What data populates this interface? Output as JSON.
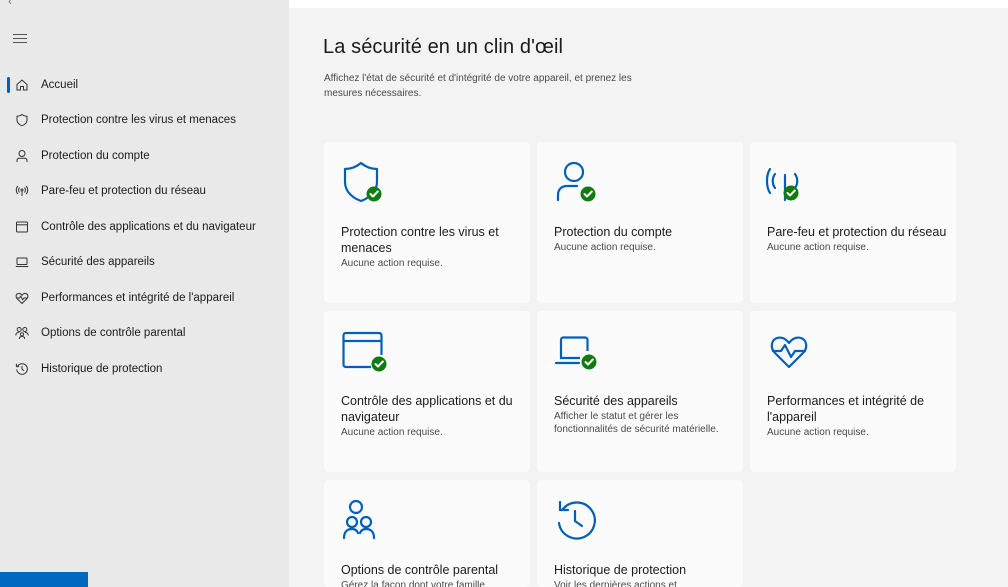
{
  "sidebar": {
    "back_glyph": "‹",
    "items": [
      {
        "label": "Accueil",
        "icon": "home-icon",
        "active": true
      },
      {
        "label": "Protection contre les virus et menaces",
        "icon": "shield-icon"
      },
      {
        "label": "Protection du compte",
        "icon": "person-icon"
      },
      {
        "label": "Pare-feu et protection du réseau",
        "icon": "wifi-signal-icon"
      },
      {
        "label": "Contrôle des applications et du navigateur",
        "icon": "app-window-icon"
      },
      {
        "label": "Sécurité des appareils",
        "icon": "laptop-icon"
      },
      {
        "label": "Performances et intégrité de l'appareil",
        "icon": "heart-pulse-icon"
      },
      {
        "label": "Options de contrôle parental",
        "icon": "family-icon"
      },
      {
        "label": "Historique de protection",
        "icon": "history-icon"
      }
    ]
  },
  "main": {
    "title": "La sécurité en un clin d'œil",
    "subtitle": "Affichez l'état de sécurité et d'intégrité de votre appareil, et prenez les mesures nécessaires.",
    "cards": [
      {
        "title": "Protection contre les virus et menaces",
        "status": "Aucune action requise.",
        "icon": "shield-check-icon"
      },
      {
        "title": "Protection du compte",
        "status": "Aucune action requise.",
        "icon": "person-check-icon"
      },
      {
        "title": "Pare-feu et protection du réseau",
        "status": "Aucune action requise.",
        "icon": "wifi-check-icon"
      },
      {
        "title": "Contrôle des applications et du navigateur",
        "status": "Aucune action requise.",
        "icon": "app-window-check-icon"
      },
      {
        "title": "Sécurité des appareils",
        "status": "Afficher le statut et gérer les fonctionnalités de sécurité matérielle.",
        "icon": "laptop-check-icon"
      },
      {
        "title": "Performances et intégrité de l'appareil",
        "status": "Aucune action requise.",
        "icon": "heart-pulse-icon"
      },
      {
        "title": "Options de contrôle parental",
        "status": "Gérez la façon dont votre famille",
        "icon": "family-icon"
      },
      {
        "title": "Historique de protection",
        "status": "Voir les dernières actions et",
        "icon": "history-icon"
      }
    ]
  },
  "colors": {
    "accent": "#005fb8",
    "check": "#107c10",
    "sidebar_bg": "#e9e9e9",
    "main_bg": "#f3f3f3",
    "card_bg": "#fbfbfb"
  }
}
